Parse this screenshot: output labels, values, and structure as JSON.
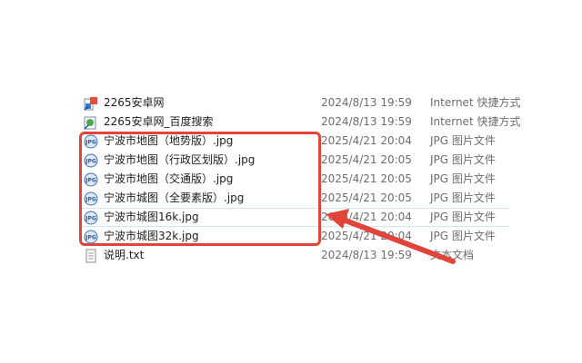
{
  "files": [
    {
      "name": "2265安卓网",
      "date": "2024/8/13 19:59",
      "type": "Internet 快捷方式",
      "icon": "internet-shortcut-icon"
    },
    {
      "name": "2265安卓网_百度搜索",
      "date": "2024/8/13 19:59",
      "type": "Internet 快捷方式",
      "icon": "internet-shortcut-icon"
    },
    {
      "name": "宁波市地图（地势版）.jpg",
      "date": "2025/4/21 20:04",
      "type": "JPG 图片文件",
      "icon": "jpg-file-icon"
    },
    {
      "name": "宁波市地图（行政区划版）.jpg",
      "date": "2025/4/21 20:05",
      "type": "JPG 图片文件",
      "icon": "jpg-file-icon"
    },
    {
      "name": "宁波市地图（交通版）.jpg",
      "date": "2025/4/21 20:05",
      "type": "JPG 图片文件",
      "icon": "jpg-file-icon"
    },
    {
      "name": "宁波市城图（全要素版）.jpg",
      "date": "2025/4/21 20:05",
      "type": "JPG 图片文件",
      "icon": "jpg-file-icon"
    },
    {
      "name": "宁波市城图16k.jpg",
      "date": "2025/4/21 20:04",
      "type": "JPG 图片文件",
      "icon": "jpg-file-icon"
    },
    {
      "name": "宁波市城图32k.jpg",
      "date": "2025/4/21 20:04",
      "type": "JPG 图片文件",
      "icon": "jpg-file-icon"
    },
    {
      "name": "说明.txt",
      "date": "2024/8/13 19:59",
      "type": "文本文档",
      "icon": "text-file-icon"
    }
  ],
  "colors": {
    "highlight": "#e0443a",
    "secondary_text": "#6d6d6d"
  }
}
